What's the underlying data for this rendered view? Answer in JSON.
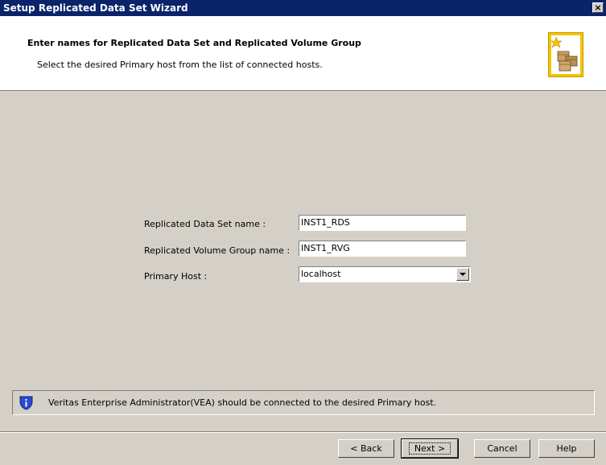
{
  "window": {
    "title": "Setup Replicated Data Set Wizard",
    "close_label": "×"
  },
  "header": {
    "title": "Enter names for Replicated Data Set and Replicated Volume Group",
    "subtitle": "Select the desired Primary host from the list of connected hosts."
  },
  "form": {
    "rds_label": "Replicated Data Set name :",
    "rds_value": "INST1_RDS",
    "rvg_label": "Replicated Volume Group name :",
    "rvg_value": "INST1_RVG",
    "host_label": "Primary Host :",
    "host_value": "localhost"
  },
  "info": {
    "message": "Veritas Enterprise Administrator(VEA) should be connected to the desired Primary host.",
    "icon": "info-shield-icon"
  },
  "buttons": {
    "back": "< Back",
    "next": "Next >",
    "cancel": "Cancel",
    "help": "Help"
  }
}
